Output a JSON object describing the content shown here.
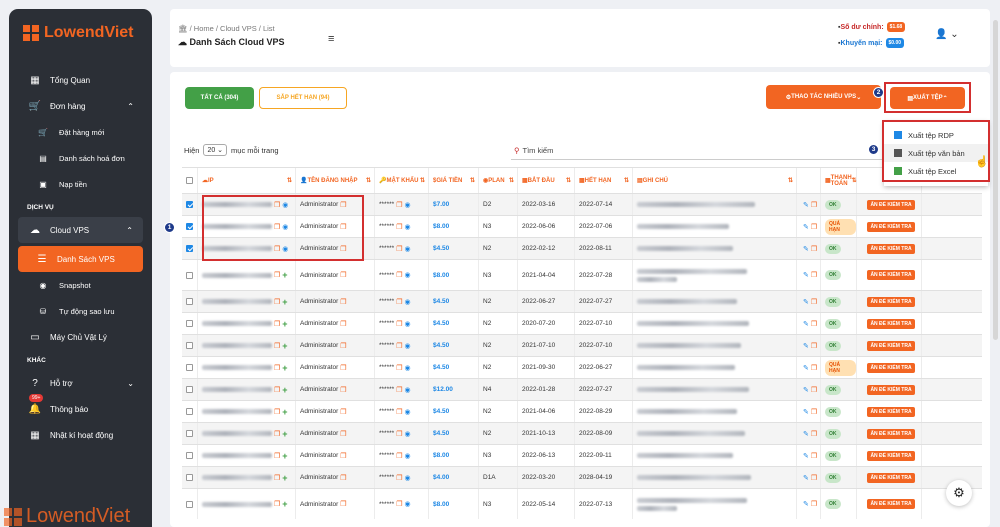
{
  "sidebar": {
    "brand": "LowendViet",
    "items": [
      {
        "label": "Tổng Quan",
        "icon": "dashboard-icon"
      },
      {
        "label": "Đơn hàng",
        "icon": "cart-icon"
      },
      {
        "label": "Đặt hàng mới",
        "icon": "cart-icon"
      },
      {
        "label": "Danh sách hoá đơn",
        "icon": "document-icon"
      },
      {
        "label": "Nạp tiền",
        "icon": "wallet-icon"
      },
      {
        "label": "Cloud VPS",
        "icon": "cloud-icon"
      },
      {
        "label": "Danh Sách VPS",
        "icon": "list-icon"
      },
      {
        "label": "Snapshot",
        "icon": "camera-icon"
      },
      {
        "label": "Tự động sao lưu",
        "icon": "backup-icon"
      },
      {
        "label": "Máy Chủ Vật Lý",
        "icon": "server-icon"
      },
      {
        "label": "Hỗ trợ",
        "icon": "help-icon"
      },
      {
        "label": "Thông báo",
        "icon": "bell-icon"
      },
      {
        "label": "Nhật kí hoạt động",
        "icon": "calendar-icon"
      }
    ],
    "sections": [
      "DỊCH VỤ",
      "KHÁC"
    ],
    "noti_badge": "99+"
  },
  "header": {
    "breadcrumb": "🏛 / Home / Cloud VPS / List",
    "title": "Danh Sách Cloud VPS",
    "balance_label": "Số dư chính:",
    "balance_value": "$1.68",
    "promo_label": "Khuyến mại:",
    "promo_value": "$0.00"
  },
  "toolbar": {
    "tab_all": "TẤT CẢ (304)",
    "tab_expiring": "SẮP HẾT HẠN (94)",
    "bulk_actions": "THAO TÁC NHIỀU VPS",
    "export": "XUẤT TỆP"
  },
  "export_menu": [
    "Xuất tệp RDP",
    "Xuất tệp văn bản",
    "Xuất tệp Excel"
  ],
  "table_controls": {
    "show_prefix": "Hiện",
    "page_size": "20",
    "show_suffix": "mục mỗi trang",
    "search_placeholder": "Tìm kiếm"
  },
  "columns": [
    "IP",
    "TÊN ĐĂNG NHẬP",
    "MẬT KHẨU",
    "GIÁ TIỀN",
    "PLAN",
    "BẮT ĐẦU",
    "HẾT HẠN",
    "GHI CHÚ",
    "THANH TOÁN"
  ],
  "rows": [
    {
      "checked": true,
      "user": "Administrator",
      "pass": "******",
      "price": "$7.00",
      "plan": "D2",
      "start": "2022-03-16",
      "end": "2022-07-14",
      "status": "OK",
      "action": "ẤN ĐỂ KIỂM TRA"
    },
    {
      "checked": true,
      "user": "Administrator",
      "pass": "******",
      "price": "$8.00",
      "plan": "N3",
      "start": "2022-06-06",
      "end": "2022-07-06",
      "status": "QUÁ HẠN",
      "action": "ẤN ĐỂ KIỂM TRA"
    },
    {
      "checked": true,
      "user": "Administrator",
      "pass": "******",
      "price": "$4.50",
      "plan": "N2",
      "start": "2022-02-12",
      "end": "2022-08-11",
      "status": "OK",
      "action": "ẤN ĐỂ KIỂM TRA"
    },
    {
      "checked": false,
      "user": "Administrator",
      "pass": "******",
      "price": "$8.00",
      "plan": "N3",
      "start": "2021-04-04",
      "end": "2022-07-28",
      "status": "OK",
      "action": "ẤN ĐỂ KIỂM TRA"
    },
    {
      "checked": false,
      "user": "Administrator",
      "pass": "******",
      "price": "$4.50",
      "plan": "N2",
      "start": "2022-06-27",
      "end": "2022-07-27",
      "status": "OK",
      "action": "ẤN ĐỂ KIỂM TRA"
    },
    {
      "checked": false,
      "user": "Administrator",
      "pass": "******",
      "price": "$4.50",
      "plan": "N2",
      "start": "2020-07-20",
      "end": "2022-07-10",
      "status": "OK",
      "action": "ẤN ĐỂ KIỂM TRA"
    },
    {
      "checked": false,
      "user": "Administrator",
      "pass": "******",
      "price": "$4.50",
      "plan": "N2",
      "start": "2021-07-10",
      "end": "2022-07-10",
      "status": "OK",
      "action": "ẤN ĐỂ KIỂM TRA"
    },
    {
      "checked": false,
      "user": "Administrator",
      "pass": "******",
      "price": "$4.50",
      "plan": "N2",
      "start": "2021-09-30",
      "end": "2022-06-27",
      "status": "QUÁ HẠN",
      "action": "ẤN ĐỂ KIỂM TRA"
    },
    {
      "checked": false,
      "user": "Administrator",
      "pass": "******",
      "price": "$12.00",
      "plan": "N4",
      "start": "2022-01-28",
      "end": "2022-07-27",
      "status": "OK",
      "action": "ẤN ĐỂ KIỂM TRA"
    },
    {
      "checked": false,
      "user": "Administrator",
      "pass": "******",
      "price": "$4.50",
      "plan": "N2",
      "start": "2021-04-06",
      "end": "2022-08-29",
      "status": "OK",
      "action": "ẤN ĐỂ KIỂM TRA"
    },
    {
      "checked": false,
      "user": "Administrator",
      "pass": "******",
      "price": "$4.50",
      "plan": "N2",
      "start": "2021-10-13",
      "end": "2022-08-09",
      "status": "OK",
      "action": "ẤN ĐỂ KIỂM TRA"
    },
    {
      "checked": false,
      "user": "Administrator",
      "pass": "******",
      "price": "$8.00",
      "plan": "N3",
      "start": "2022-06-13",
      "end": "2022-09-11",
      "status": "OK",
      "action": "ẤN ĐỂ KIỂM TRA"
    },
    {
      "checked": false,
      "user": "Administrator",
      "pass": "******",
      "price": "$4.00",
      "plan": "D1A",
      "start": "2022-03-20",
      "end": "2028-04-19",
      "status": "OK",
      "action": "ẤN ĐỂ KIỂM TRA"
    },
    {
      "checked": false,
      "user": "Administrator",
      "pass": "******",
      "price": "$8.00",
      "plan": "N3",
      "start": "2022-05-14",
      "end": "2022-07-13",
      "status": "OK",
      "action": "ẤN ĐỂ KIỂM TRA"
    }
  ],
  "callouts": [
    "1",
    "2",
    "3"
  ],
  "colors": {
    "brand": "#f26522",
    "sidebar": "#2b2f36",
    "ok": "#43a047",
    "link": "#1e88e5",
    "highlight": "#d32f2f"
  }
}
